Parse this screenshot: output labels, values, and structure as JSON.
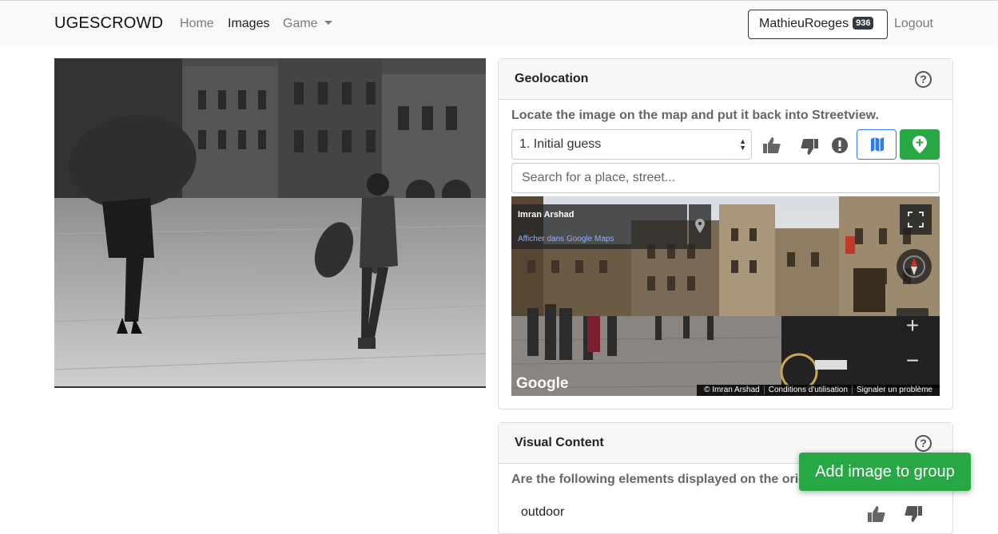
{
  "navbar": {
    "brand": "UGESCROWD",
    "links": [
      {
        "label": "Home",
        "icon": "none"
      },
      {
        "label": "Images",
        "icon": "none"
      },
      {
        "label": "Game",
        "icon": "caret-down-icon"
      }
    ],
    "user": {
      "name": "MathieuRoeges",
      "score": "936"
    },
    "logout_label": "Logout"
  },
  "photo": {
    "icon": "black-and-white-photo-image"
  },
  "geolocation": {
    "title": "Geolocation",
    "instruction": "Locate the image on the map and put it back into Streetview.",
    "guess_select": {
      "value": "1. Initial guess"
    },
    "search_placeholder": "Search for a place, street...",
    "streetview": {
      "author": "Imran Arshad",
      "maps_link": "Afficher dans Google Maps",
      "logo": "Google",
      "footer": [
        "© Imran Arshad",
        "Conditions d'utilisation",
        "Signaler un problème"
      ]
    },
    "icons": [
      "help-icon",
      "thumbs-up-icon",
      "thumbs-down-icon",
      "alert-icon",
      "map-icon",
      "pin-icon",
      "fullscreen-icon",
      "compass-icon",
      "zoom-in-icon",
      "zoom-out-icon"
    ]
  },
  "visual_content": {
    "title": "Visual Content",
    "question": "Are the following elements displayed on the orig",
    "items": [
      {
        "label": "outdoor"
      }
    ]
  },
  "add_group_label": "Add image to group",
  "colors": {
    "green": "#28a745",
    "blue": "#2b7de9",
    "navbar_bg": "#f8f9fa"
  }
}
